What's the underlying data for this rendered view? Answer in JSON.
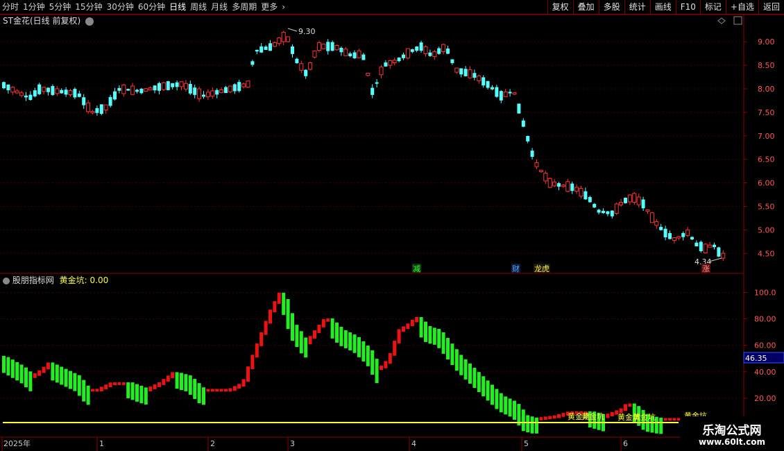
{
  "toolbar": {
    "periods": [
      "分时",
      "1分钟",
      "5分钟",
      "15分钟",
      "30分钟",
      "60分钟",
      "日线",
      "周线",
      "月线",
      "多周期",
      "更多"
    ],
    "more_arrow": "›",
    "right_buttons": [
      "复权",
      "叠加",
      "多股",
      "统计",
      "画线",
      "F10",
      "标记",
      "+自选",
      "返回"
    ]
  },
  "main_panel": {
    "title": "ST金花(日线 前复权)",
    "y_ticks": [
      "9.00",
      "8.50",
      "8.00",
      "7.50",
      "7.00",
      "6.50",
      "6.00",
      "5.50",
      "5.00",
      "4.50"
    ],
    "high_label": "9.30",
    "low_label": "4.34",
    "markers": [
      "减",
      "财",
      "龙虎",
      "涨"
    ]
  },
  "indicator_panel": {
    "name": "股朋指标网",
    "series_label": "黄金坑:",
    "series_value": "0.00",
    "y_ticks": [
      "100.0",
      "80.00",
      "60.00",
      "40.00",
      "20.00"
    ],
    "current_value": "46.35",
    "hk_label": "黄金坑"
  },
  "x_axis": {
    "labels": [
      "2025年",
      "1",
      "2",
      "3",
      "4",
      "5",
      "6"
    ]
  },
  "watermark": {
    "line1": "乐淘公式网",
    "line2": "www.60lt.com"
  },
  "colors": {
    "up": "#ff3333",
    "down": "#54ffff",
    "ind_up": "#ee1111",
    "ind_down": "#22ee22",
    "yellow": "#ffff33",
    "axis": "#8b0000"
  }
}
